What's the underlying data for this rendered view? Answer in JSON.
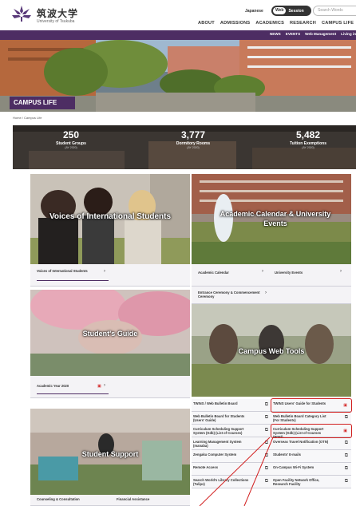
{
  "header": {
    "university_jp": "筑波大学",
    "university_en": "University of Tsukuba",
    "lang_label": "Japanese",
    "toggle": [
      "Web",
      "Session"
    ],
    "search_placeholder": "Search Words",
    "nav": [
      "ABOUT",
      "ADMISSIONS",
      "ACADEMICS",
      "RESEARCH",
      "CAMPUS LIFE"
    ],
    "subnav": [
      "NEWS",
      "EVENTS",
      "Web Management",
      "Living in"
    ]
  },
  "hero": {
    "title": "CAMPUS LIFE"
  },
  "breadcrumb": "Home  /  Campus Life",
  "stats": [
    {
      "num": "250",
      "label": "Student Groups",
      "year": "(AY 2020)"
    },
    {
      "num": "3,777",
      "label": "Dormitory Rooms",
      "year": "(AY 2020)"
    },
    {
      "num": "5,482",
      "label": "Tuition Exemptions",
      "year": "(AY 2020)"
    }
  ],
  "tiles": {
    "voices": {
      "title": "Voices of International Students",
      "link": "Voices of International Students"
    },
    "calendar": {
      "title": "Academic Calendar & University Events",
      "links": [
        "Academic Calendar",
        "University Events",
        "Entrance Ceremony & Commencement Ceremony"
      ]
    },
    "guide": {
      "title": "Student's Guide",
      "link": "Academic Year 2020"
    },
    "tools": {
      "title": "Campus Web Tools"
    },
    "support": {
      "title": "Student Support",
      "links": [
        "Counseling & Consultation",
        "Financial Assistance"
      ]
    }
  },
  "web_tools": [
    "TWINS / Web Bulletin Board",
    "TWINS Users' Guide for Students",
    "Web Bulletin Board for Students (Users' Guide)",
    "Web Bulletin Board Category List (For Students)",
    "Curriculum Scheduling Support System (Kdb) (List of Courses)",
    "Curriculum Scheduling Support System (Kdb) (List of Courses (PDF))",
    "Learning Management System (manaba)",
    "Overseas Travel Notification (OTN)",
    "Zengaku Computer System",
    "Students' E-mails",
    "Remote Access",
    "On-Campus Wi-Fi System",
    "Search World's Library Collections (Tulips)",
    "Open Facility Network Office, Research Facility"
  ],
  "colors": {
    "brand": "#4d2d63",
    "highlight": "#d21f1f"
  }
}
